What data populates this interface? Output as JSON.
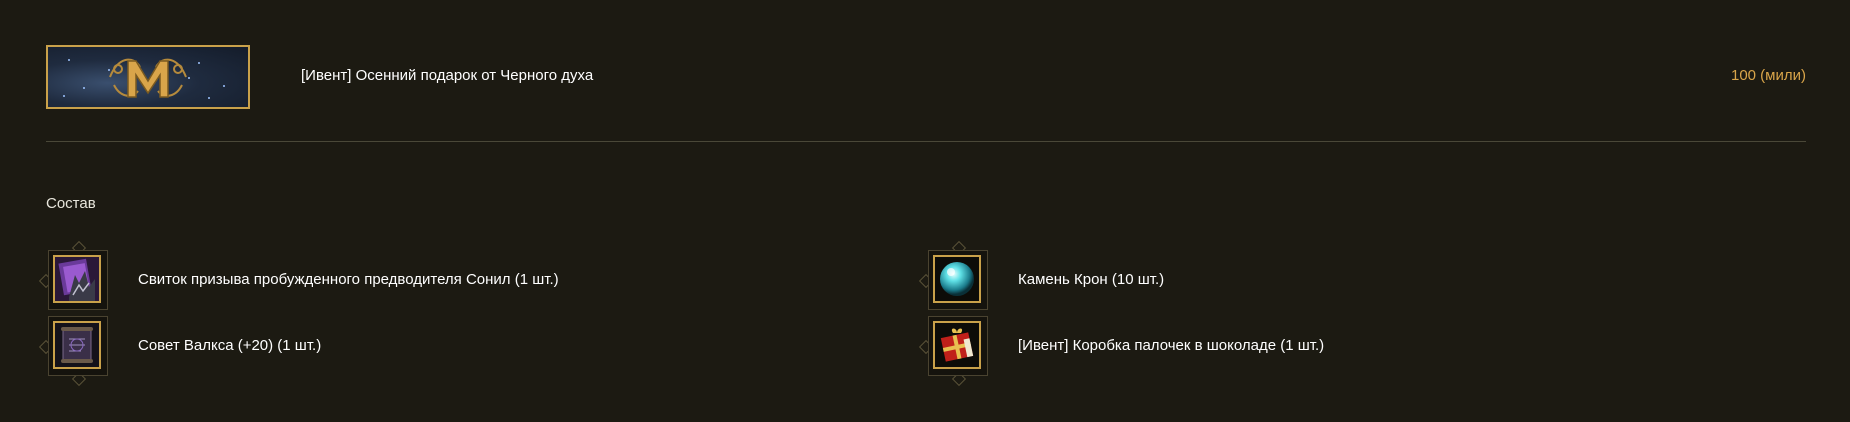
{
  "header": {
    "banner_icon": "m-emblem-banner",
    "title": "[Ивент] Осенний подарок от Черного духа",
    "price": "100 (мили)"
  },
  "contents": {
    "section_title": "Состав",
    "items": [
      {
        "label": "Свиток призыва пробужденного предводителя Сонил (1 шт.)",
        "icon": "purple-scroll-icon"
      },
      {
        "label": "Камень Крон (10 шт.)",
        "icon": "cyan-orb-icon"
      },
      {
        "label": "Совет Валкса (+20) (1 шт.)",
        "icon": "dark-scroll-icon"
      },
      {
        "label": "[Ивент] Коробка палочек в шоколаде (1 шт.)",
        "icon": "red-gift-box-icon"
      }
    ]
  },
  "colors": {
    "background": "#1c1a12",
    "gold_border": "#c9a14a",
    "price_text": "#d9a54a",
    "divider": "#4a4838"
  }
}
